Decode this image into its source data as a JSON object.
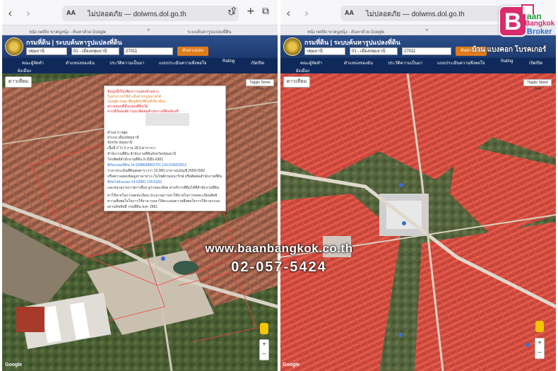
{
  "safari": {
    "back": "‹",
    "forward": "›",
    "aa": "AA",
    "url": "ไม่ปลอดภัย — dolwms.dol.go.th",
    "reload": "↻",
    "share": "⇪",
    "plus": "+",
    "tabs": "⧉"
  },
  "tabbar": {
    "tab1": "หนัง netflix ขาคนูหนุ้ง - ค้นหาด้วย Google",
    "tab2": "ระบบค้นหารูปแปลงที่ดิน",
    "close": "×"
  },
  "dol": {
    "title": "กรมที่ดิน | ระบบค้นหารูปแปลงที่ดิน",
    "province": "ปทุมธานี",
    "district": "01 - เมืองปทุมธานี",
    "parcel": "27011",
    "search_button": "ค้นหาแปลง",
    "menu": [
      "คณะผู้จัดทำ",
      "ตำแหน่งของฉัน",
      "ประวัติความเป็นมา",
      "แบบประเมินความพึงพอใจ",
      "Rating",
      "เปิด/ปิด"
    ],
    "menu2": "ผังเมือง"
  },
  "map": {
    "map_type": "ดาวเทียม",
    "street_view": "Toggle Street View",
    "zoom_in": "+",
    "zoom_out": "−",
    "google": "Google"
  },
  "popup": {
    "lines": [
      {
        "text": "ข้อมูลนี้เป็นเพียงการแสดงตัวอย่าง",
        "color": "red"
      },
      {
        "text": "ไม่สามารถใช้อ้างอิงทางกฎหมายได้",
        "color": "orange"
      },
      {
        "text": "Google map เพื่อดูพิกัดที่ดินที่เกี่ยวข้อง",
        "color": "orange"
      },
      {
        "text": "ตรวจสอบที่ตั้งแปลงที่ดินได้",
        "color": "red"
      },
      {
        "text": "หากมีข้อสงสัย กรุณาติดต่อสำนักงานที่ดินท้องที่",
        "color": "red"
      },
      {
        "text": "ตำบล  บางพูด",
        "color": "dark"
      },
      {
        "text": "อำเภอ  เมืองปทุมธานี",
        "color": "dark"
      },
      {
        "text": "จังหวัด  ปทุมธานี",
        "color": "dark"
      },
      {
        "text": "เนื้อที่  0 ไร่ 0 งาน 18.0 ตารางวา",
        "color": "dark"
      },
      {
        "text": "สำนักงานที่ดิน  สำนักงานที่ดินจังหวัดปทุมธานี",
        "color": "dark"
      },
      {
        "text": "โทรศัพท์สำนักงานที่ดิน  0-2581-6301",
        "color": "dark"
      },
      {
        "text": "พิกัดแปลงที่ดิน  14.0288698802701 100.534263012",
        "color": "blue"
      },
      {
        "text": "ราคาประเมินที่ดินต่อตารางวา  22,000 บาท รอบบัญชี 2559-2562",
        "color": "dark"
      },
      {
        "text": "หรือตรวจสอบข้อมูลราคาทาง เว็บไซต์กรมธนารักษ์ หรือติดต่อสำนักงานที่ดิน",
        "color": "dark"
      },
      {
        "text": "พิกัดไปยังแปลง  14.02881 100.5342",
        "color": "blue"
      },
      {
        "text": "และหน่วยงานราชการอื่นๆ ดูรายละเอียด ค่าบริการที่ดินได้ที่สำนักงานที่ดิน",
        "color": "dark"
      },
      {
        "text": "ค่าใช้จ่ายในการจดทะเบียน  ประมาณการค่าใช้จ่ายในการจดทะเบียนสิทธิ",
        "color": "dark"
      },
      {
        "text": "ความพึงพอใจในการใช้งาน  กรุณาให้คะแนนความพึงพอใจการใช้งานระบบ",
        "color": "dark"
      },
      {
        "text": "สงวนลิขสิทธิ์ กรมที่ดิน พ.ศ. 2561",
        "color": "dark"
      }
    ]
  },
  "watermark": {
    "url": "www.baanbangkok.co.th",
    "phone": "02-057-5424"
  },
  "brand": {
    "letter": "B",
    "line1": "aan",
    "line2": "Bangkok",
    "line3": "Broker",
    "caption": "บ้าน แบงคอก โบรคเกอร์"
  }
}
